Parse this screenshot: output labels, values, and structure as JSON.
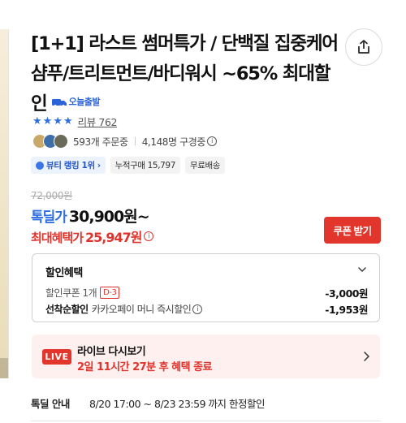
{
  "product": {
    "title": "[1+1] 라스트 썸머특가 / 단백질 집중케어 샴푸/트리트먼트/바디워시 ~65% 최대할인",
    "delivery_badge": "오늘출발"
  },
  "rating": {
    "stars": 4,
    "review_label": "리뷰 762"
  },
  "social": {
    "orders": "593개 주문중",
    "viewers": "4,148명 구경중"
  },
  "tags": [
    "뷰티 랭킹 1위",
    "누적구매 15,797",
    "무료배송"
  ],
  "price": {
    "original": "72,000원",
    "deal_label": "톡딜가",
    "deal_price": "30,900원~",
    "max_label": "최대혜택가",
    "max_price": "25,947원",
    "coupon_button": "쿠폰 받기"
  },
  "discount": {
    "title": "할인혜택",
    "coupon_label": "할인쿠폰 1개",
    "coupon_badge": "D-3",
    "coupon_amount": "-3,000원",
    "first_label": "선착순할인",
    "first_sub": "카카오페이 머니 즉시할인",
    "first_amount": "-1,953원"
  },
  "live": {
    "badge": "LIVE",
    "title": "라이브 다시보기",
    "subtitle": "2일 11시간 27분 후 혜택 종료"
  },
  "period": {
    "label": "톡딜 안내",
    "value": "8/20 17:00 ~ 8/23 23:59 까지 한정할인"
  },
  "colors": {
    "accent_blue": "#2f6ee0",
    "accent_red": "#e2352b",
    "live_bg": "#fdf0ef"
  }
}
